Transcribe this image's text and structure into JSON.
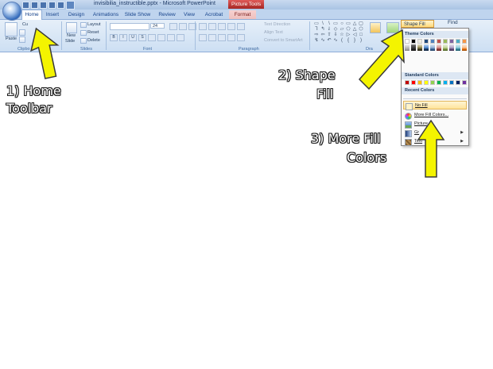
{
  "window": {
    "title": "invisibilia_instructible.pptx - Microsoft PowerPoint",
    "context_tab": "Picture Tools"
  },
  "tabs": [
    "Home",
    "Insert",
    "Design",
    "Animations",
    "Slide Show",
    "Review",
    "View",
    "Acrobat",
    "Format"
  ],
  "active_tab": "Home",
  "ribbon": {
    "clipboard": {
      "label": "Clipbo",
      "paste": "Paste",
      "cut": "Cu"
    },
    "slides": {
      "label": "Slides",
      "new_slide": "New",
      "new_slide_2": "Slide",
      "layout": "Layout",
      "reset": "Reset",
      "delete": "Delete"
    },
    "font": {
      "label": "Font",
      "size": "24",
      "bold": "B",
      "italic": "I",
      "underline": "U",
      "strike": "S"
    },
    "paragraph": {
      "label": "Paragraph",
      "text_direction": "Text Direction",
      "align_text": "Align Text",
      "convert": "Convert to SmartArt"
    },
    "drawing": {
      "label": "Dra"
    },
    "shape_fill": "Shape Fill",
    "find": "Find"
  },
  "shape_fill_menu": {
    "theme_colors_title": "Theme Colors",
    "standard_colors_title": "Standard Colors",
    "recent_colors_title": "Recent Colors",
    "items": [
      {
        "label": "No Fill",
        "icon": "no-fill-icon"
      },
      {
        "label": "More Fill Colors...",
        "icon": "palette-icon"
      },
      {
        "label": "Picture...",
        "icon": "picture-icon"
      },
      {
        "label": "Gr",
        "icon": "gradient-icon"
      },
      {
        "label": "Text",
        "icon": "texture-icon"
      }
    ],
    "theme_row": [
      "#ffffff",
      "#000000",
      "#eeece1",
      "#1f497d",
      "#4f81bd",
      "#c0504d",
      "#9bbb59",
      "#8064a2",
      "#4bacc6",
      "#f79646"
    ],
    "standard_colors": [
      "#c00000",
      "#ff0000",
      "#ffc000",
      "#ffff00",
      "#92d050",
      "#00b050",
      "#00b0f0",
      "#0070c0",
      "#002060",
      "#7030a0"
    ]
  },
  "annotations": {
    "step1_line1": "1) Home",
    "step1_line2": "Toolbar",
    "step2_line1": "2) Shape",
    "step2_line2": "Fill",
    "step3_line1": "3) More Fill",
    "step3_line2": "Colors"
  },
  "colors": {
    "arrow_fill": "#f4f400",
    "arrow_stroke": "#3b3b3b"
  }
}
